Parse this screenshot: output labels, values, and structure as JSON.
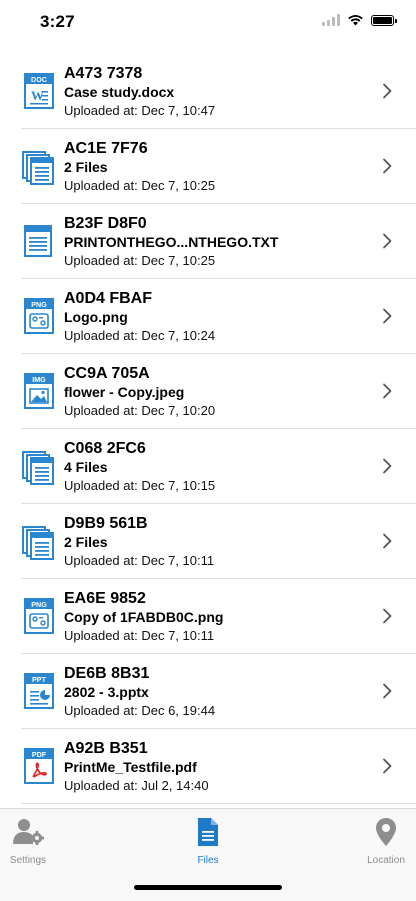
{
  "status": {
    "time": "3:27"
  },
  "files": [
    {
      "code": "A473 7378",
      "name": "Case study.docx",
      "uploaded": "Uploaded at: Dec 7, 10:47",
      "icon": "doc-icon",
      "badge": "DOC"
    },
    {
      "code": "AC1E 7F76",
      "name": "2 Files",
      "uploaded": "Uploaded at: Dec 7, 10:25",
      "icon": "multi-file-icon",
      "badge": ""
    },
    {
      "code": "B23F D8F0",
      "name": "PRINTONTHEGO...NTHEGO.TXT",
      "uploaded": "Uploaded at: Dec 7, 10:25",
      "icon": "txt-icon",
      "badge": ""
    },
    {
      "code": "A0D4 FBAF",
      "name": "Logo.png",
      "uploaded": "Uploaded at: Dec 7, 10:24",
      "icon": "png-icon",
      "badge": "PNG"
    },
    {
      "code": "CC9A 705A",
      "name": "flower - Copy.jpeg",
      "uploaded": "Uploaded at: Dec 7, 10:20",
      "icon": "img-icon",
      "badge": "IMG"
    },
    {
      "code": "C068 2FC6",
      "name": "4 Files",
      "uploaded": "Uploaded at: Dec 7, 10:15",
      "icon": "multi-file-icon",
      "badge": ""
    },
    {
      "code": "D9B9 561B",
      "name": "2 Files",
      "uploaded": "Uploaded at: Dec 7, 10:11",
      "icon": "multi-file-icon",
      "badge": ""
    },
    {
      "code": "EA6E 9852",
      "name": "Copy of 1FABDB0C.png",
      "uploaded": "Uploaded at: Dec 7, 10:11",
      "icon": "png-icon",
      "badge": "PNG"
    },
    {
      "code": "DE6B 8B31",
      "name": "2802 - 3.pptx",
      "uploaded": "Uploaded at: Dec 6, 19:44",
      "icon": "ppt-icon",
      "badge": "PPT"
    },
    {
      "code": "A92B B351",
      "name": "PrintMe_Testfile.pdf",
      "uploaded": "Uploaded at: Jul 2, 14:40",
      "icon": "pdf-icon",
      "badge": "PDF"
    }
  ],
  "tabs": [
    {
      "label": "Settings",
      "icon": "settings-icon",
      "active": false
    },
    {
      "label": "Files",
      "icon": "files-icon",
      "active": true
    },
    {
      "label": "Location",
      "icon": "location-pin-icon",
      "active": false
    }
  ],
  "colors": {
    "accent": "#1f7ac8",
    "inactive": "#8e8e8e",
    "icon_blue": "#2a86cf"
  }
}
